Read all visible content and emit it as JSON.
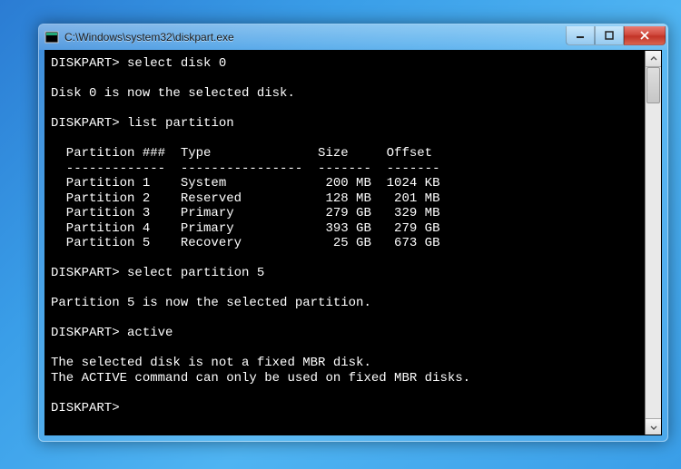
{
  "window": {
    "title": "C:\\Windows\\system32\\diskpart.exe"
  },
  "term": {
    "prompt": "DISKPART>",
    "cmd_select_disk": "select disk 0",
    "resp_select_disk": "Disk 0 is now the selected disk.",
    "cmd_list_partition": "list partition",
    "tbl_header": "  Partition ###  Type              Size     Offset",
    "tbl_divider": "  -------------  ----------------  -------  -------",
    "tbl_row1": "  Partition 1    System             200 MB  1024 KB",
    "tbl_row2": "  Partition 2    Reserved           128 MB   201 MB",
    "tbl_row3": "  Partition 3    Primary            279 GB   329 MB",
    "tbl_row4": "  Partition 4    Primary            393 GB   279 GB",
    "tbl_row5": "  Partition 5    Recovery            25 GB   673 GB",
    "cmd_select_partition": "select partition 5",
    "resp_select_partition": "Partition 5 is now the selected partition.",
    "cmd_active": "active",
    "resp_active_1": "The selected disk is not a fixed MBR disk.",
    "resp_active_2": "The ACTIVE command can only be used on fixed MBR disks."
  }
}
